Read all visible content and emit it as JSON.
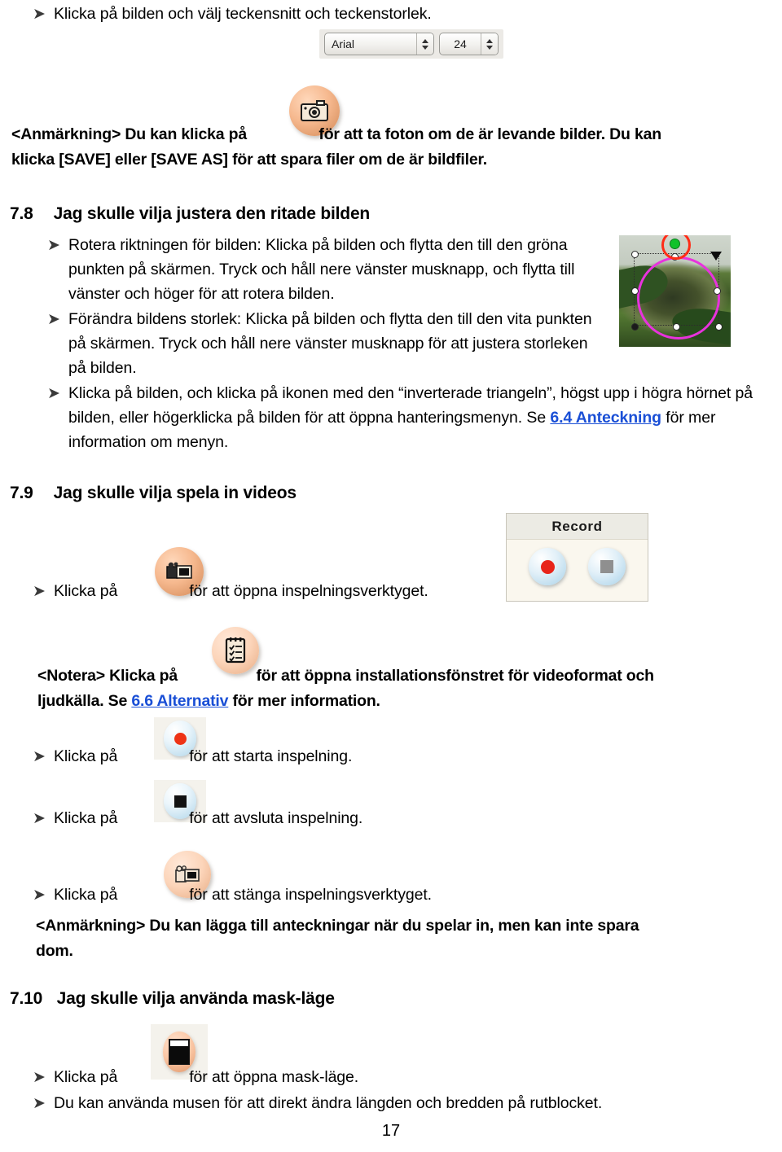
{
  "document": {
    "page_number": "17",
    "link_color": "#1a4fd6",
    "bullet_glyph": "➤"
  },
  "intro": {
    "bullet1": "Klicka på bilden och välj teckensnitt och teckenstorlek.",
    "font_toolbar": {
      "font_name": "Arial",
      "font_size": "24"
    },
    "note": {
      "prefix": "<Anmärkning> Du kan klicka på",
      "icon": "photo-camera-icon",
      "middle": "för att ta foton om de är levande bilder. Du kan",
      "line2": "klicka [SAVE] eller [SAVE AS] för att spara filer om de är bildfiler."
    }
  },
  "section_78": {
    "number": "7.8",
    "title": "Jag skulle vilja justera den ritade bilden",
    "bullets": [
      "Rotera riktningen för bilden: Klicka på bilden och flytta den till den gröna punkten på skärmen. Tryck och håll nere vänster musknapp, och flytta till vänster och höger för att rotera bilden.",
      "Förändra bildens storlek: Klicka på bilden och flytta den till den vita punkten på skärmen. Tryck och håll nere vänster musknapp för att justera storleken på bilden."
    ],
    "bullet3": {
      "part1": "Klicka på bilden, och klicka på ikonen med den “inverterade triangeln”, högst upp i högra hörnet på bilden, eller högerklicka på bilden för att öppna hanteringsmenyn. Se ",
      "link": "6.4 Anteckning",
      "part2": " för mer information om menyn."
    },
    "thumbnail": "frog-image-selection-thumbnail"
  },
  "section_79": {
    "number": "7.9",
    "title": "Jag skulle vilja spela in videos",
    "record_panel": {
      "title": "Record",
      "record_button": "record-button",
      "stop_button": "stop-button"
    },
    "bullet_open": {
      "before": "Klicka på",
      "icon": "camcorder-icon",
      "after": "för att öppna inspelningsverktyget."
    },
    "note": {
      "prefix": "<Notera> Klicka på",
      "icon": "options-checklist-icon",
      "middle": "för att öppna installationsfönstret för videoformat och",
      "line2_before": "ljudkälla. Se ",
      "link": "6.6 Alternativ",
      "line2_after": " för mer information."
    },
    "bullet_start": {
      "before": "Klicka på",
      "icon": "record-round-icon",
      "after": "för att starta inspelning."
    },
    "bullet_stop": {
      "before": "Klicka på",
      "icon": "stop-square-icon",
      "after": "för att avsluta inspelning."
    },
    "bullet_close": {
      "before": "Klicka på",
      "icon": "camcorder-close-icon",
      "after": "för att stänga inspelningsverktyget."
    },
    "note2": {
      "line1": "<Anmärkning> Du kan lägga till anteckningar när du spelar in, men kan inte spara",
      "line2": "dom."
    }
  },
  "section_710": {
    "number": "7.10",
    "title": "Jag skulle vilja använda mask-läge",
    "bullet_open": {
      "before": "Klicka på",
      "icon": "mask-mode-icon",
      "after": "för att öppna mask-läge."
    },
    "bullet_mouse": "Du kan använda musen för att direkt ändra längden och bredden på rutblocket."
  }
}
